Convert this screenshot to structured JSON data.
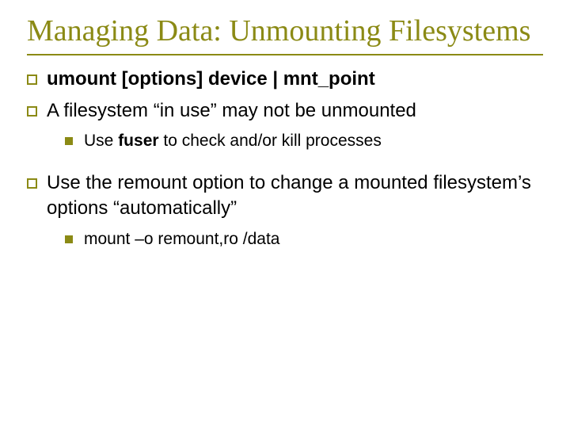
{
  "title": "Managing Data: Unmounting Filesystems",
  "bullets": {
    "b1_1_pre": "umount [options] device | mnt_point",
    "b1_2_pre": "A filesystem “in use” may not be unmounted",
    "b2_1_a": "Use ",
    "b2_1_b": "fuser",
    "b2_1_c": " to check and/or kill processes",
    "b1_3": "Use the remount option to change a mounted filesystem’s options “automatically”",
    "b2_2": "mount –o remount,ro /data"
  }
}
